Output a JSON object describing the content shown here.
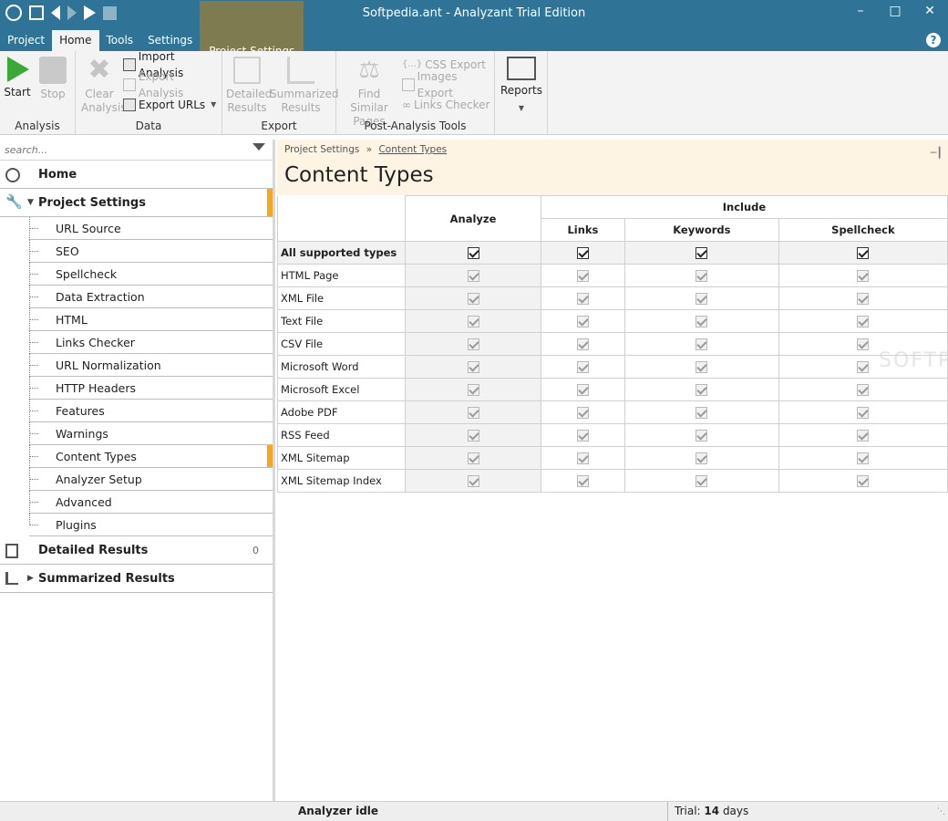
{
  "window": {
    "title": "Softpedia.ant - Analyzant Trial Edition"
  },
  "tabs": {
    "project": "Project",
    "home": "Home",
    "tools": "Tools",
    "settings": "Settings",
    "project_settings": "Project Settings"
  },
  "ribbon": {
    "analysis": {
      "label": "Analysis",
      "start": "Start",
      "stop": "Stop"
    },
    "data": {
      "label": "Data",
      "clear": "Clear Analysis",
      "import": "Import Analysis",
      "export": "Export Analysis",
      "export_urls": "Export URLs"
    },
    "export": {
      "label": "Export",
      "detailed": "Detailed Results",
      "summarized": "Summarized Results"
    },
    "post": {
      "label": "Post-Analysis Tools",
      "find_similar": "Find Similar Pages",
      "css_export": "CSS Export",
      "images_export": "Images Export",
      "links_checker": "Links Checker"
    },
    "reports": {
      "label": "Reports"
    }
  },
  "sidebar": {
    "search_placeholder": "search...",
    "home": "Home",
    "project_settings": "Project Settings",
    "items": [
      "URL Source",
      "SEO",
      "Spellcheck",
      "Data Extraction",
      "HTML",
      "Links Checker",
      "URL Normalization",
      "HTTP Headers",
      "Features",
      "Warnings",
      "Content Types",
      "Analyzer Setup",
      "Advanced",
      "Plugins"
    ],
    "detailed_results": "Detailed Results",
    "detailed_count": "0",
    "summarized_results": "Summarized Results"
  },
  "main": {
    "breadcrumb_parent": "Project Settings",
    "breadcrumb_sep": "»",
    "breadcrumb_current": "Content Types",
    "title": "Content Types",
    "headers": {
      "analyze": "Analyze",
      "include": "Include",
      "links": "Links",
      "keywords": "Keywords",
      "spellcheck": "Spellcheck"
    },
    "all_row": "All supported types",
    "rows": [
      "HTML Page",
      "XML File",
      "Text File",
      "CSV File",
      "Microsoft Word",
      "Microsoft Excel",
      "Adobe PDF",
      "RSS Feed",
      "XML Sitemap",
      "XML Sitemap Index"
    ]
  },
  "status": {
    "state": "Analyzer idle",
    "trial_prefix": "Trial:",
    "trial_days": "14",
    "trial_suffix": "days"
  },
  "colors": {
    "title_bar": "#2f7496",
    "context_tab": "#7f7b50",
    "accent": "#f5a623",
    "header_bg": "#fdf4e3"
  }
}
